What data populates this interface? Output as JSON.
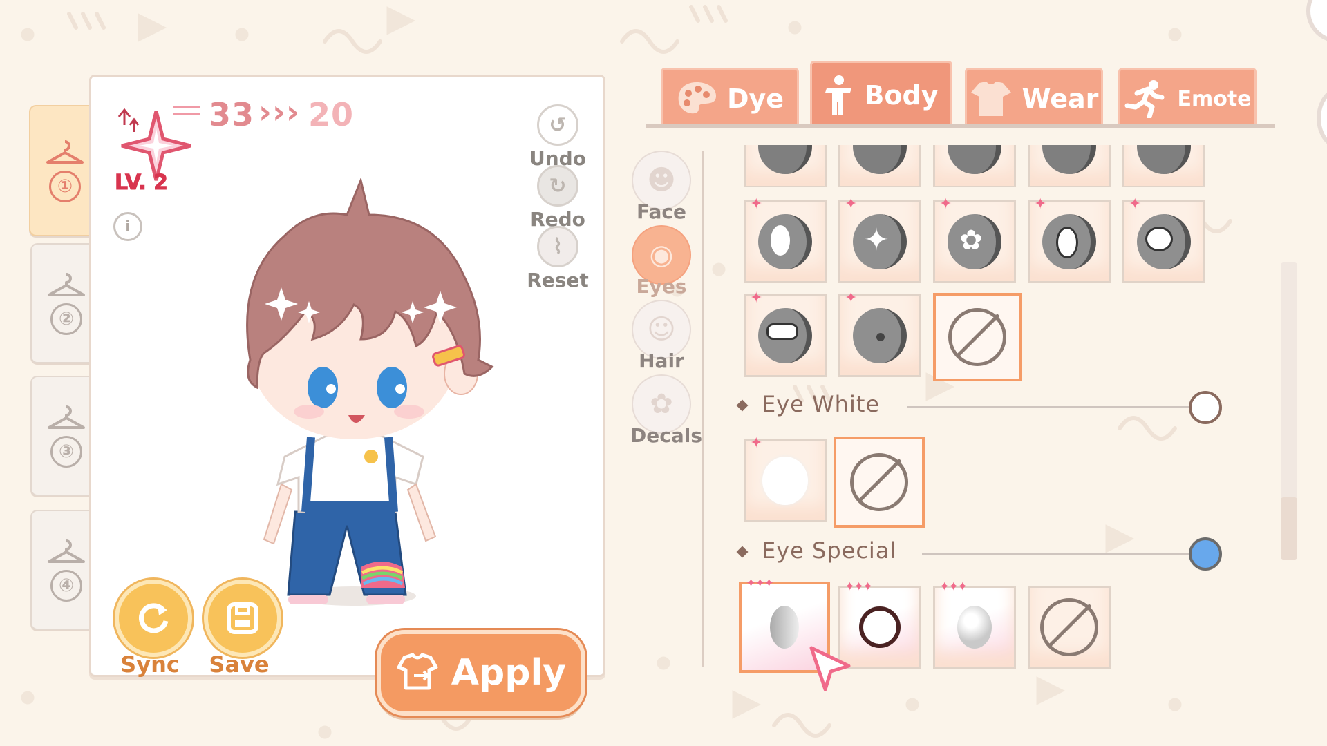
{
  "slots": [
    {
      "label": "①",
      "active": true
    },
    {
      "label": "②",
      "active": false
    },
    {
      "label": "③",
      "active": false
    },
    {
      "label": "④",
      "active": false
    }
  ],
  "preview": {
    "level_badge": "LV. 2",
    "count_current": "33",
    "count_arrows": "›››",
    "count_target": "20",
    "undo_label": "Undo",
    "redo_label": "Redo",
    "reset_label": "Reset",
    "info_icon": "i"
  },
  "bottom": {
    "sync_label": "Sync",
    "save_label": "Save",
    "apply_label": "Apply"
  },
  "tabs": [
    {
      "label": "Dye",
      "icon": "palette-icon"
    },
    {
      "label": "Body",
      "icon": "person-icon",
      "active": true
    },
    {
      "label": "Wear",
      "icon": "shirt-icon"
    },
    {
      "label": "Emote",
      "icon": "running-icon"
    }
  ],
  "categories": [
    {
      "label": "Face",
      "icon": "face-icon"
    },
    {
      "label": "Eyes",
      "icon": "eye-icon",
      "active": true
    },
    {
      "label": "Hair",
      "icon": "hair-icon"
    },
    {
      "label": "Decals",
      "icon": "flower-icon"
    }
  ],
  "sections": {
    "eye_white": "Eye White",
    "eye_special": "Eye Special"
  },
  "sliders": {
    "eye_white_level": 1.0,
    "eye_special_level": 1.0
  },
  "colors": {
    "tab": "#f4a589",
    "accent": "#f59c67",
    "selected_knob": "#68a8ec"
  }
}
